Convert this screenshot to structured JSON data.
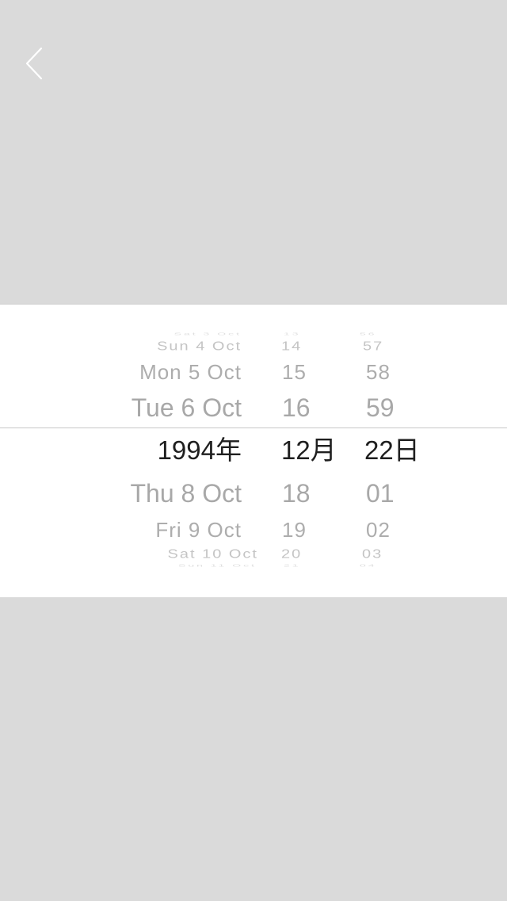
{
  "nav": {
    "back_icon": "chevron-left-icon"
  },
  "picker": {
    "columns": {
      "day": {
        "above": [
          "Sat 3 Oct",
          "Sun 4 Oct",
          "Mon 5 Oct",
          "Tue 6 Oct"
        ],
        "selected": "1994年",
        "below": [
          "Thu 8 Oct",
          "Fri 9 Oct",
          "Sat 10 Oct",
          "Sun 11 Oct"
        ]
      },
      "hour": {
        "above": [
          "13",
          "14",
          "15",
          "16"
        ],
        "selected": "12月",
        "below": [
          "18",
          "19",
          "20",
          "21"
        ]
      },
      "minute": {
        "above": [
          "56",
          "57",
          "58",
          "59"
        ],
        "selected": "22日",
        "below": [
          "01",
          "02",
          "03",
          "04"
        ]
      }
    }
  },
  "colors": {
    "background": "#dadada",
    "panel": "#ffffff",
    "selected_text": "#1f1f1f",
    "faded_text": "#a8a8a8"
  }
}
